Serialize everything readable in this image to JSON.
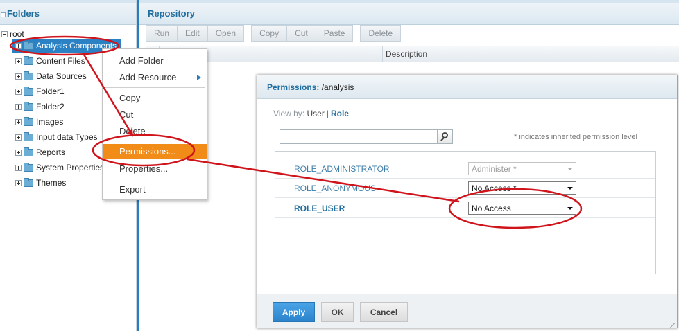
{
  "folders": {
    "title": "Folders",
    "tree": [
      {
        "label": "root",
        "expander": "minus"
      },
      {
        "label": "Analysis Components",
        "expander": "plus",
        "selected": true
      },
      {
        "label": "Content Files",
        "expander": "plus"
      },
      {
        "label": "Data Sources",
        "expander": "plus"
      },
      {
        "label": "Folder1",
        "expander": "plus"
      },
      {
        "label": "Folder2",
        "expander": "plus"
      },
      {
        "label": "Images",
        "expander": "plus"
      },
      {
        "label": "Input data Types",
        "expander": "plus"
      },
      {
        "label": "Reports",
        "expander": "plus"
      },
      {
        "label": "System Properties",
        "expander": "plus"
      },
      {
        "label": "Themes",
        "expander": "plus"
      }
    ]
  },
  "repository": {
    "title": "Repository",
    "toolbar": {
      "run": "Run",
      "edit": "Edit",
      "open": "Open",
      "copy": "Copy",
      "cut": "Cut",
      "paste": "Paste",
      "delete": "Delete"
    },
    "columns": {
      "description": "Description"
    }
  },
  "context_menu": {
    "items": [
      {
        "label": "Add Folder"
      },
      {
        "label": "Add Resource",
        "submenu": true
      },
      {
        "label": "Copy"
      },
      {
        "label": "Cut"
      },
      {
        "label": "Delete"
      },
      {
        "label": "Permissions...",
        "highlighted": true
      },
      {
        "label": "Properties..."
      },
      {
        "label": "Export"
      }
    ]
  },
  "dialog": {
    "title_label": "Permissions:",
    "title_path": "/analysis",
    "view_by_label": "View by:",
    "view_by_user": "User",
    "view_by_role": "Role",
    "search_value": "",
    "inherited_note": "* indicates inherited permission level",
    "roles": [
      {
        "name": "ROLE_ADMINISTRATOR",
        "permission": "Administer *",
        "disabled": true
      },
      {
        "name": "ROLE_ANONYMOUS",
        "permission": "No Access *",
        "disabled": false
      },
      {
        "name": "ROLE_USER",
        "permission": "No Access",
        "disabled": false
      }
    ],
    "buttons": {
      "apply": "Apply",
      "ok": "OK",
      "cancel": "Cancel"
    }
  },
  "colors": {
    "accent": "#2a7dbd",
    "menu_highlight": "#f28c18",
    "annotation": "#d0141c"
  }
}
